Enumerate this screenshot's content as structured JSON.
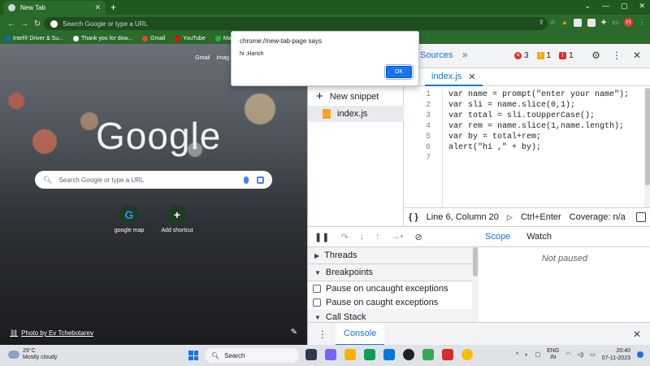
{
  "browser": {
    "tab_title": "New Tab",
    "new_tab_symbol": "+",
    "omnibox_placeholder": "Search Google or type a URL",
    "profile_initial": "H",
    "bookmarks": [
      "Intel® Driver & Su...",
      "Thank you for dow...",
      "Gmail",
      "YouTube",
      "Maps"
    ]
  },
  "ntp": {
    "top_links": [
      "Gmail",
      "Imag"
    ],
    "logo": "Google",
    "search_placeholder": "Search Google or type a URL",
    "shortcuts": [
      {
        "label": "google map",
        "glyph": "G"
      },
      {
        "label": "Add shortcut",
        "glyph": "+"
      }
    ],
    "photo_credit": "Photo by Ev Tchebotarev"
  },
  "dialog": {
    "title": "chrome://new-tab-page says",
    "message": "hi ,Harish",
    "ok_label": "OK"
  },
  "devtools": {
    "active_panel": "Sources",
    "more_tabs": "»",
    "errors": "3",
    "warnings": "1",
    "issues": "1",
    "new_snippet_label": "New snippet",
    "snippet_file": "index.js",
    "editor_tab": "index.js",
    "line_numbers": [
      "1",
      "2",
      "3",
      "4",
      "5",
      "6",
      "7"
    ],
    "code_lines": [
      "var name = prompt(\"enter your name\");",
      "var sli = name.slice(0,1);",
      "var total = sli.toUpperCase();",
      "var rem = name.slice(1,name.length);",
      "var by = total+rem;",
      "alert(\"hi ,\" + by);",
      ""
    ],
    "status_position": "Line 6, Column 20",
    "run_shortcut": "Ctrl+Enter",
    "coverage": "Coverage: n/a",
    "threads_label": "Threads",
    "breakpoints_label": "Breakpoints",
    "pause_uncaught": "Pause on uncaught exceptions",
    "pause_caught": "Pause on caught exceptions",
    "call_stack_label": "Call Stack",
    "scope_tab": "Scope",
    "watch_tab": "Watch",
    "not_paused": "Not paused",
    "console_tab": "Console"
  },
  "taskbar": {
    "temperature": "29°C",
    "weather": "Mostly cloudy",
    "search_label": "Search",
    "lang_top": "ENG",
    "lang_bottom": "IN",
    "time": "20:40",
    "date": "07-11-2023"
  },
  "colors": {
    "chrome_green": "#2a6a2a",
    "accent_blue": "#1a73e8",
    "error_red": "#d93025",
    "warning_yellow": "#f9ab00"
  }
}
